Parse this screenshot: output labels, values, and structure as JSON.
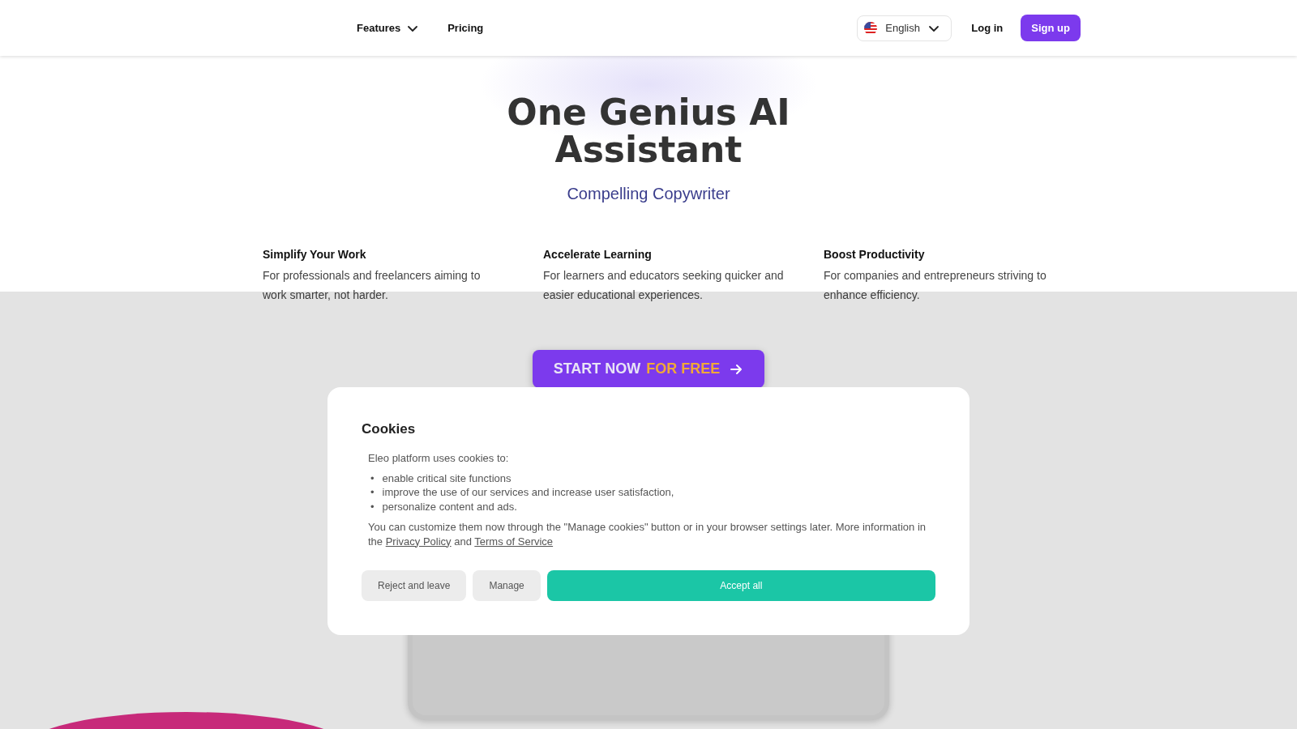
{
  "nav": {
    "items": [
      {
        "label": "Features",
        "kind": "dropdown"
      },
      {
        "label": "Pricing",
        "kind": "link"
      }
    ],
    "language": "English",
    "login": "Log in",
    "signup": "Sign up"
  },
  "hero": {
    "title": "One Genius AI Assistant",
    "subtitle": "Compelling Copywriter"
  },
  "features": [
    {
      "title": "Simplify Your Work",
      "text": "For professionals and freelancers aiming to work smarter, not harder."
    },
    {
      "title": "Accelerate Learning",
      "text": "For learners and educators seeking quicker and easier educational experiences."
    },
    {
      "title": "Boost Productivity",
      "text": "For companies and entrepreneurs striving to enhance efficiency."
    }
  ],
  "cta": {
    "label": "START NOW",
    "highlight": "FOR FREE"
  },
  "cookies": {
    "title": "Cookies",
    "marker": "•",
    "intro": "Eleo platform uses cookies to:",
    "bullets": [
      "enable critical site functions",
      "improve the use of our services and increase user satisfaction,",
      "personalize content and ads."
    ],
    "info": {
      "text": "You can customize them now through the \"Manage cookies\" button or in your browser settings later. More information in the",
      "link_1": "Privacy Policy",
      "joiner": "and",
      "link_2": "Terms of Service"
    },
    "buttons": [
      {
        "label": "Reject and leave",
        "kind": "secondary"
      },
      {
        "label": "Manage",
        "kind": "secondary"
      },
      {
        "label": "Accept all",
        "kind": "primary"
      }
    ]
  }
}
